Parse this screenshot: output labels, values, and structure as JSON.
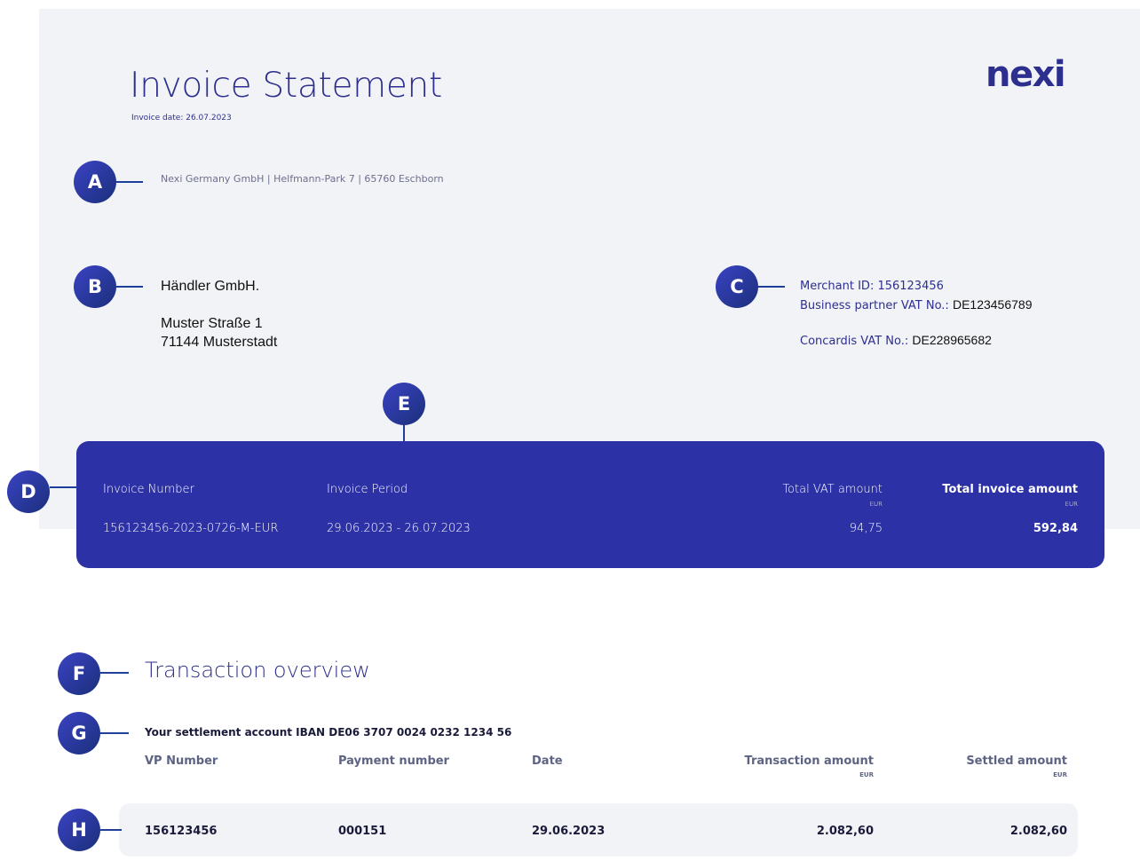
{
  "header": {
    "title": "Invoice Statement",
    "invoice_date": "Invoice date: 26.07.2023",
    "logo": "nexi"
  },
  "sender_line": "Nexi Germany GmbH | Helfmann-Park 7 | 65760 Eschborn",
  "recipient": {
    "name": "Händler GmbH.",
    "street": "Muster Straße 1",
    "city": "71144 Musterstadt"
  },
  "merchant": {
    "merchant_id": "Merchant ID: 156123456",
    "bp_vat_label": "Business partner VAT No.:",
    "bp_vat_value": "DE123456789",
    "concardis_vat_label": "Concardis VAT No.:",
    "concardis_vat_value": "DE228965682"
  },
  "markers": {
    "a": "A",
    "b": "B",
    "c": "C",
    "d": "D",
    "e": "E",
    "f": "F",
    "g": "G",
    "h": "H"
  },
  "summary": {
    "invoice_number_label": "Invoice Number",
    "invoice_number": "156123456-2023-0726-M-EUR",
    "invoice_period_label": "Invoice Period",
    "invoice_period": "29.06.2023 - 26.07.2023",
    "total_vat_label": "Total VAT amount",
    "total_vat_currency": "EUR",
    "total_vat": "94,75",
    "total_invoice_label": "Total invoice amount",
    "total_invoice_currency": "EUR",
    "total_invoice": "592,84"
  },
  "transactions": {
    "title": "Transaction overview",
    "iban_line": "Your settlement account IBAN DE06 3707 0024 0232 1234 56",
    "columns": {
      "vp_number": "VP Number",
      "payment_number": "Payment number",
      "date": "Date",
      "transaction_amount": "Transaction amount",
      "transaction_currency": "EUR",
      "settled_amount": "Settled amount",
      "settled_currency": "EUR"
    },
    "rows": [
      {
        "vp_number": "156123456",
        "payment_number": "000151",
        "date": "29.06.2023",
        "transaction_amount": "2.082,60",
        "settled_amount": "2.082,60"
      }
    ]
  }
}
